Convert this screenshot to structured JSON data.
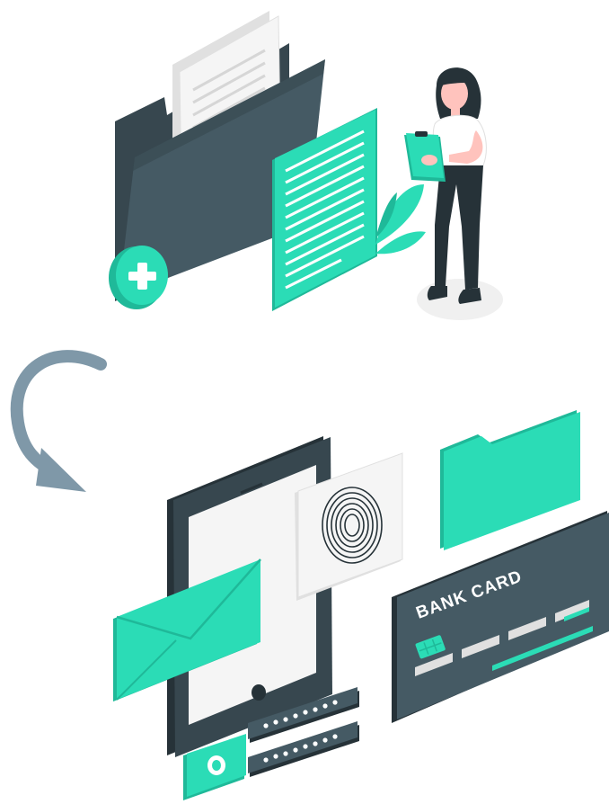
{
  "illustration": {
    "bank_card_label": "BANK CARD"
  },
  "colors": {
    "accent": "#2bdcb6",
    "accent_dark": "#1fb999",
    "dark": "#37474f",
    "dark_alt": "#455a64",
    "light": "#f5f5f5",
    "arrow": "#7f98a8"
  },
  "icons": [
    "folder-icon",
    "document-icon",
    "plus-badge-icon",
    "clipboard-icon",
    "plant-icon",
    "curved-arrow-icon",
    "tablet-icon",
    "envelope-icon",
    "fingerprint-icon",
    "folder-icon",
    "bank-card-icon",
    "password-field-icon",
    "camera-icon"
  ]
}
